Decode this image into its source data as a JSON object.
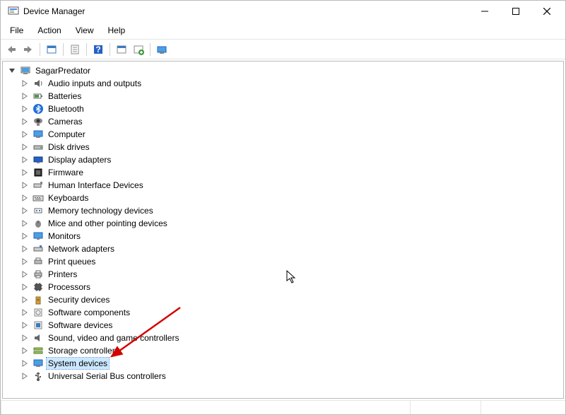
{
  "window": {
    "title": "Device Manager"
  },
  "menu": {
    "file": "File",
    "action": "Action",
    "view": "View",
    "help": "Help"
  },
  "toolbar_icons": {
    "back": "back-icon",
    "forward": "forward-icon",
    "show_hidden": "show-hidden-icon",
    "properties": "properties-icon",
    "help": "help-icon",
    "update": "update-icon",
    "uninstall": "uninstall-icon",
    "scan": "scan-icon"
  },
  "tree": {
    "root": "SagarPredator",
    "children": [
      {
        "label": "Audio inputs and outputs",
        "icon": "audio-icon"
      },
      {
        "label": "Batteries",
        "icon": "battery-icon"
      },
      {
        "label": "Bluetooth",
        "icon": "bluetooth-icon"
      },
      {
        "label": "Cameras",
        "icon": "camera-icon"
      },
      {
        "label": "Computer",
        "icon": "computer-icon"
      },
      {
        "label": "Disk drives",
        "icon": "disk-icon"
      },
      {
        "label": "Display adapters",
        "icon": "display-icon"
      },
      {
        "label": "Firmware",
        "icon": "firmware-icon"
      },
      {
        "label": "Human Interface Devices",
        "icon": "hid-icon"
      },
      {
        "label": "Keyboards",
        "icon": "keyboard-icon"
      },
      {
        "label": "Memory technology devices",
        "icon": "memory-icon"
      },
      {
        "label": "Mice and other pointing devices",
        "icon": "mouse-icon"
      },
      {
        "label": "Monitors",
        "icon": "monitor-icon"
      },
      {
        "label": "Network adapters",
        "icon": "network-icon"
      },
      {
        "label": "Print queues",
        "icon": "printqueue-icon"
      },
      {
        "label": "Printers",
        "icon": "printer-icon"
      },
      {
        "label": "Processors",
        "icon": "cpu-icon"
      },
      {
        "label": "Security devices",
        "icon": "security-icon"
      },
      {
        "label": "Software components",
        "icon": "softcomp-icon"
      },
      {
        "label": "Software devices",
        "icon": "softdev-icon"
      },
      {
        "label": "Sound, video and game controllers",
        "icon": "sound-icon"
      },
      {
        "label": "Storage controllers",
        "icon": "storage-icon"
      },
      {
        "label": "System devices",
        "icon": "system-icon",
        "selected": true
      },
      {
        "label": "Universal Serial Bus controllers",
        "icon": "usb-icon"
      }
    ]
  }
}
